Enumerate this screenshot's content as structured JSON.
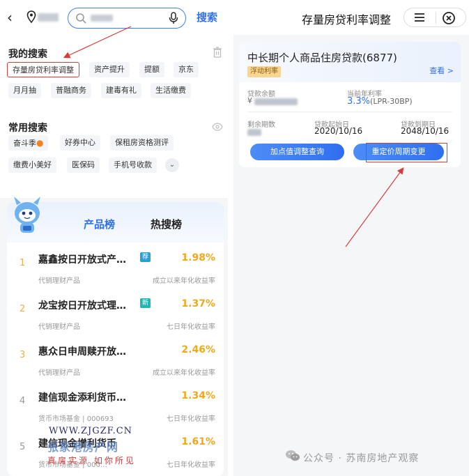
{
  "left": {
    "search_button": "搜索",
    "my_search": {
      "title": "我的搜索",
      "tags": [
        "存量房贷利率调整",
        "资产提升",
        "提额",
        "京东",
        "月月抽",
        "普融商务",
        "建毒有礼",
        "生活缴费"
      ]
    },
    "common_search": {
      "title": "常用搜索",
      "tags": [
        "奋斗季",
        "好券中心",
        "保租房资格测评",
        "缴费小美好",
        "医保码",
        "手机号收款"
      ]
    },
    "ranking": {
      "tabs": [
        "产品榜",
        "热搜榜"
      ],
      "items": [
        {
          "rank": "1",
          "name": "嘉鑫按日开放式产…",
          "tag": "荐",
          "tag_color": "#2aa0d8",
          "rate": "1.98%",
          "sub": "代销理财产品",
          "sub_right": "成立以来年化收益率"
        },
        {
          "rank": "2",
          "name": "龙宝按日开放式理…",
          "tag": "新",
          "tag_color": "#22b6b0",
          "rate": "1.37%",
          "sub": "代销理财产品",
          "sub_right": "七日年化收益率"
        },
        {
          "rank": "3",
          "name": "惠众日申周赎开放…",
          "tag": "",
          "tag_color": "",
          "rate": "2.46%",
          "sub": "代销理财产品",
          "sub_right": "成立以来年化收益率"
        },
        {
          "rank": "4",
          "name": "建信现金添利货币…",
          "tag": "",
          "tag_color": "",
          "rate": "1.34%",
          "sub": "货币市场基金 | 000693",
          "sub_right": "七日年化收益率"
        },
        {
          "rank": "5",
          "name": "建信现金增利货币",
          "tag": "",
          "tag_color": "",
          "rate": "1.61%",
          "sub": "货币市场基金 | 000…",
          "sub_right": "七日年化收益率"
        }
      ]
    },
    "watermark": {
      "url": "WWW.ZJGZF.CN",
      "name": "张家港房产网",
      "slogan": "真房实源 如你所见"
    }
  },
  "right": {
    "title": "存量房贷利率调整",
    "loan": {
      "title": "中长期个人商品住房贷款(6877)",
      "badge": "浮动利率",
      "view": "查看 >",
      "balance_label": "贷款余额",
      "balance_prefix": "¥",
      "rate_label": "当前年利率",
      "rate_value": "3.3%",
      "rate_detail": "(LPR-30BP)",
      "periods_label": "剩余期数",
      "start_label": "贷款起始日",
      "start_value": "2020/10/16",
      "end_label": "贷款到期日",
      "end_value": "2048/10/16",
      "btn_left": "加点值调整查询",
      "btn_right": "重定价周期变更"
    },
    "footer": "公众号 · 苏南房地产观察"
  },
  "colors": {
    "accent": "#2f6ff0",
    "annotation": "#d93a3a",
    "rate": "#f3a81a"
  }
}
